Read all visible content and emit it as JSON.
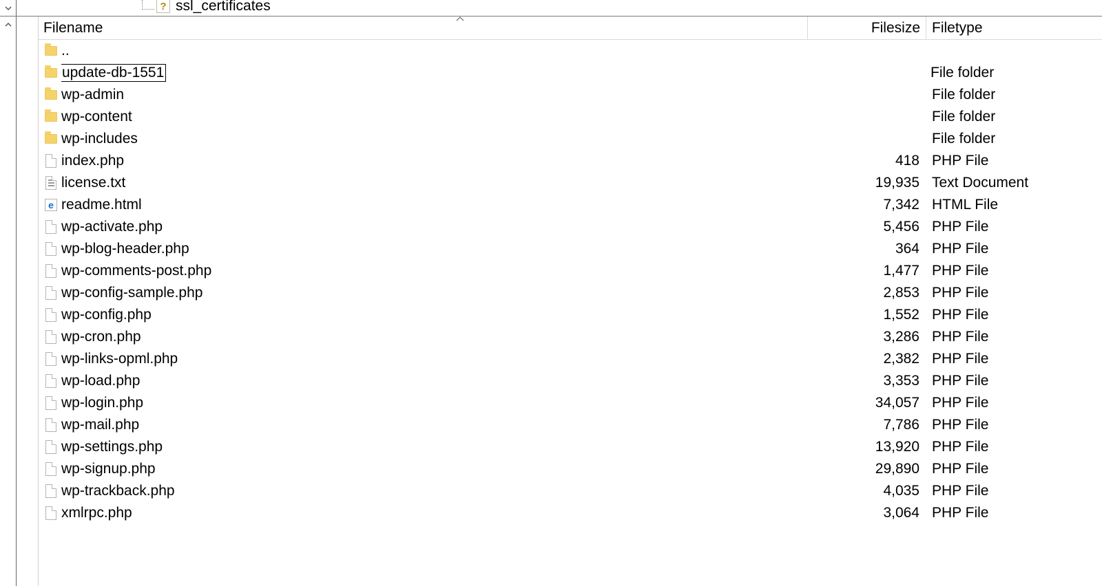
{
  "tree": {
    "visible_item_label": "ssl_certificates"
  },
  "columns": {
    "filename": "Filename",
    "filesize": "Filesize",
    "filetype": "Filetype"
  },
  "rows": [
    {
      "icon": "folder",
      "name": "..",
      "size": "",
      "type": "",
      "editing": false
    },
    {
      "icon": "folder",
      "name": "update-db-1551",
      "size": "",
      "type": "File folder",
      "editing": true
    },
    {
      "icon": "folder",
      "name": "wp-admin",
      "size": "",
      "type": "File folder",
      "editing": false
    },
    {
      "icon": "folder",
      "name": "wp-content",
      "size": "",
      "type": "File folder",
      "editing": false
    },
    {
      "icon": "folder",
      "name": "wp-includes",
      "size": "",
      "type": "File folder",
      "editing": false
    },
    {
      "icon": "file",
      "name": "index.php",
      "size": "418",
      "type": "PHP File",
      "editing": false
    },
    {
      "icon": "txt",
      "name": "license.txt",
      "size": "19,935",
      "type": "Text Document",
      "editing": false
    },
    {
      "icon": "html",
      "name": "readme.html",
      "size": "7,342",
      "type": "HTML File",
      "editing": false
    },
    {
      "icon": "file",
      "name": "wp-activate.php",
      "size": "5,456",
      "type": "PHP File",
      "editing": false
    },
    {
      "icon": "file",
      "name": "wp-blog-header.php",
      "size": "364",
      "type": "PHP File",
      "editing": false
    },
    {
      "icon": "file",
      "name": "wp-comments-post.php",
      "size": "1,477",
      "type": "PHP File",
      "editing": false
    },
    {
      "icon": "file",
      "name": "wp-config-sample.php",
      "size": "2,853",
      "type": "PHP File",
      "editing": false
    },
    {
      "icon": "file",
      "name": "wp-config.php",
      "size": "1,552",
      "type": "PHP File",
      "editing": false
    },
    {
      "icon": "file",
      "name": "wp-cron.php",
      "size": "3,286",
      "type": "PHP File",
      "editing": false
    },
    {
      "icon": "file",
      "name": "wp-links-opml.php",
      "size": "2,382",
      "type": "PHP File",
      "editing": false
    },
    {
      "icon": "file",
      "name": "wp-load.php",
      "size": "3,353",
      "type": "PHP File",
      "editing": false
    },
    {
      "icon": "file",
      "name": "wp-login.php",
      "size": "34,057",
      "type": "PHP File",
      "editing": false
    },
    {
      "icon": "file",
      "name": "wp-mail.php",
      "size": "7,786",
      "type": "PHP File",
      "editing": false
    },
    {
      "icon": "file",
      "name": "wp-settings.php",
      "size": "13,920",
      "type": "PHP File",
      "editing": false
    },
    {
      "icon": "file",
      "name": "wp-signup.php",
      "size": "29,890",
      "type": "PHP File",
      "editing": false
    },
    {
      "icon": "file",
      "name": "wp-trackback.php",
      "size": "4,035",
      "type": "PHP File",
      "editing": false
    },
    {
      "icon": "file",
      "name": "xmlrpc.php",
      "size": "3,064",
      "type": "PHP File",
      "editing": false
    }
  ]
}
